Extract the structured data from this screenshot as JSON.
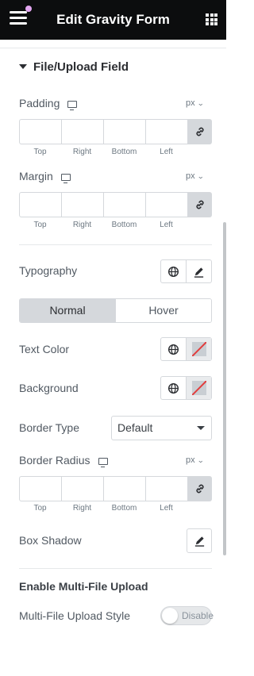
{
  "header": {
    "title": "Edit Gravity Form"
  },
  "section": {
    "title": "File/Upload Field"
  },
  "padding": {
    "label": "Padding",
    "unit": "px",
    "dims": [
      "Top",
      "Right",
      "Bottom",
      "Left"
    ]
  },
  "margin": {
    "label": "Margin",
    "unit": "px",
    "dims": [
      "Top",
      "Right",
      "Bottom",
      "Left"
    ]
  },
  "typography": {
    "label": "Typography"
  },
  "state_tabs": {
    "normal": "Normal",
    "hover": "Hover"
  },
  "text_color": {
    "label": "Text Color"
  },
  "background": {
    "label": "Background"
  },
  "border_type": {
    "label": "Border Type",
    "value": "Default"
  },
  "border_radius": {
    "label": "Border Radius",
    "unit": "px",
    "dims": [
      "Top",
      "Right",
      "Bottom",
      "Left"
    ]
  },
  "box_shadow": {
    "label": "Box Shadow"
  },
  "multi_file": {
    "title": "Enable Multi-File Upload",
    "style_label": "Multi-File Upload Style",
    "toggle_text": "Disable"
  },
  "colors": {
    "topbar": "#0c0d0e",
    "notification_dot": "#e2a6f0",
    "unset_swatch_strike": "#e23c3c"
  }
}
